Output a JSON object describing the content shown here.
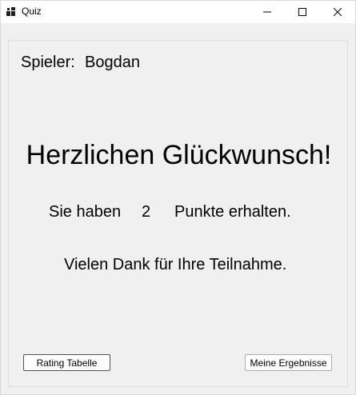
{
  "window": {
    "title": "Quiz",
    "app_icon": "app-icon",
    "controls": {
      "minimize_icon": "minimize-icon",
      "maximize_icon": "maximize-icon",
      "close_icon": "close-icon"
    }
  },
  "player": {
    "label": "Spieler:",
    "name": "Bogdan"
  },
  "headline": "Herzlichen Glückwunsch!",
  "result": {
    "prefix": "Sie haben",
    "score": "2",
    "suffix": "Punkte erhalten."
  },
  "thanks": "Vielen Dank für Ihre Teilnahme.",
  "buttons": {
    "rating": "Rating Tabelle",
    "my_results": "Meine Ergebnisse"
  },
  "colors": {
    "focus_border": "#0067c0",
    "background": "#f0f0f0"
  }
}
